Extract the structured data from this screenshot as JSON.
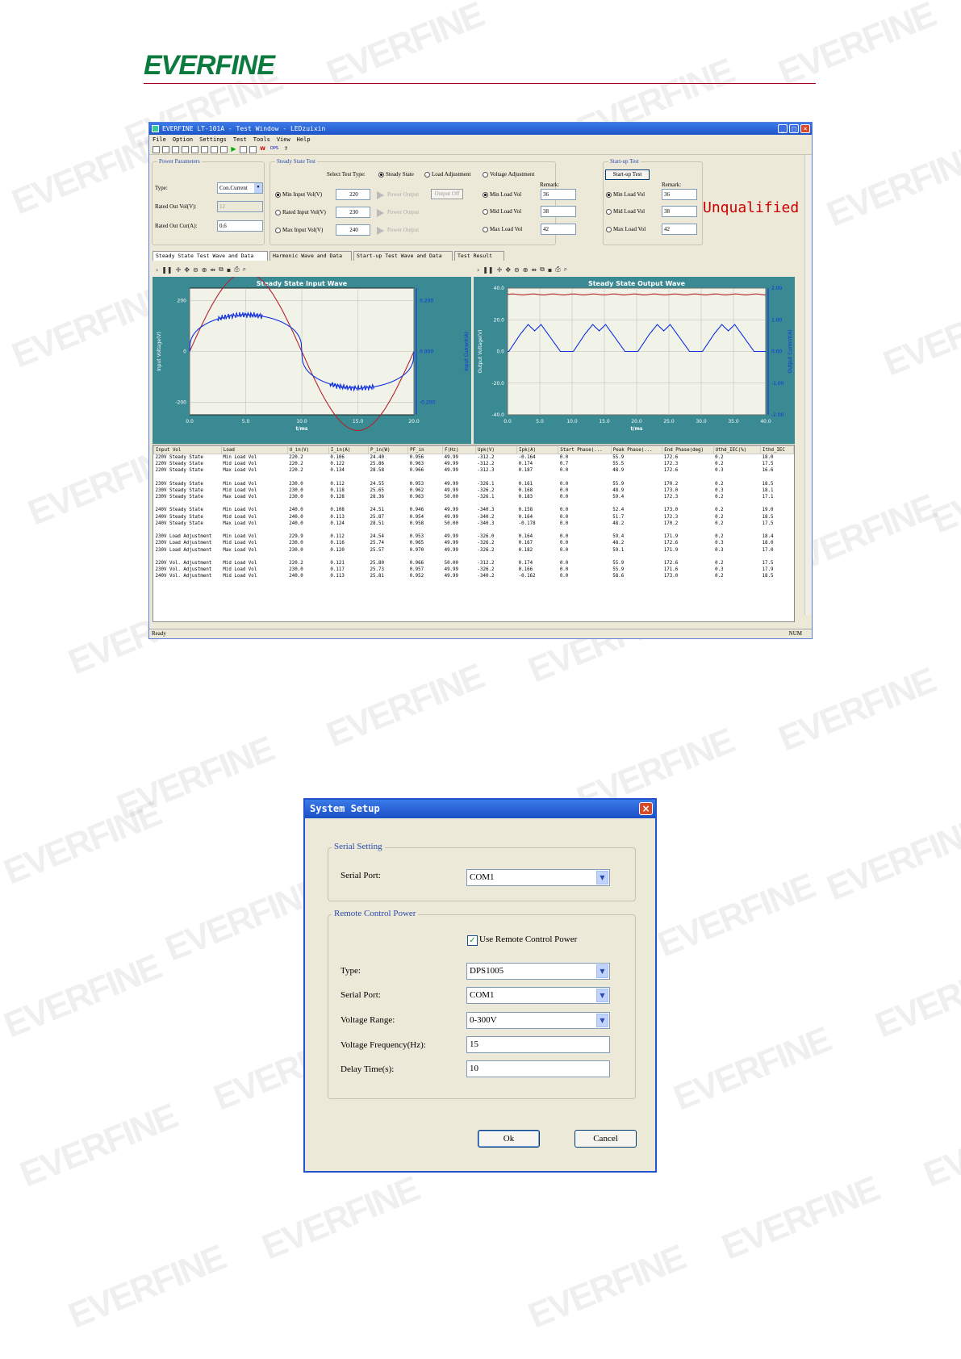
{
  "brand": {
    "logo": "EVERFINE",
    "watermark": "EVERFINE"
  },
  "app": {
    "title": "EVERFINE LT-101A - Test Window - LEDzuixin",
    "menu": [
      "File",
      "Option",
      "Settings",
      "Test",
      "Tools",
      "View",
      "Help"
    ],
    "power_params": {
      "title": "Power Parameters",
      "type_label": "Type:",
      "type_value": "Con.Current",
      "rated_vol_label": "Rated Out Vol(V):",
      "rated_vol_value": "12",
      "rated_cur_label": "Rated Out Cur(A):",
      "rated_cur_value": "0.6"
    },
    "steady": {
      "title": "Steady State Test",
      "select_label": "Select Test Type:",
      "opt_steady": "Steady State",
      "opt_load": "Load Adjustment",
      "opt_voltage": "Voltage Adjustment",
      "remark_label": "Remark:",
      "min_in_label": "Min  Input Vol(V)",
      "min_in_value": "220",
      "rated_in_label": "Rated Input Vol(V)",
      "rated_in_value": "230",
      "max_in_label": "Max  Input Vol(V)",
      "max_in_value": "240",
      "power_output": "Power Output",
      "output_off": "Output Off",
      "min_load": "Min Load Vol",
      "min_load_val": "36",
      "mid_load": "Mid Load Vol",
      "mid_load_val": "38",
      "max_load": "Max Load Vol",
      "max_load_val": "42"
    },
    "startup": {
      "title": "Start-up Test",
      "button": "Start-up Test",
      "remark_label": "Remark:",
      "min_load": "Min Load Vol",
      "min_load_val": "36",
      "mid_load": "Mid Load Vol",
      "mid_load_val": "38",
      "max_load": "Max Load Vol",
      "max_load_val": "42"
    },
    "result": "Unqualified",
    "tabs": [
      "Steady State Test Wave and Data",
      "Harmonic Wave and Data",
      "Start-up Test Wave and Data",
      "Test Result"
    ],
    "table": {
      "headers": [
        "Input Vol",
        "Load",
        "U_in(V)",
        "I_in(A)",
        "P_in(W)",
        "PF_in",
        "F(Hz)",
        "Upk(V)",
        "Ipk(A)",
        "Start Phase(...",
        "Peak Phase(...",
        "End Phase(deg)",
        "Uthd_IEC(%)",
        "Ithd_IEC"
      ],
      "rows": [
        [
          "220V Steady State",
          "Min Load Vol",
          "220.2",
          "0.106",
          "24.40",
          "0.956",
          "49.99",
          "-312.2",
          "-0.164",
          "0.0",
          "55.9",
          "172.6",
          "0.2",
          "18.0"
        ],
        [
          "220V Steady State",
          "Mid Load Vol",
          "220.2",
          "0.122",
          "25.86",
          "0.963",
          "49.99",
          "-312.2",
          "0.174",
          "0.7",
          "55.5",
          "172.3",
          "0.2",
          "17.5"
        ],
        [
          "220V Steady State",
          "Max Load Vol",
          "220.2",
          "0.134",
          "28.58",
          "0.966",
          "49.99",
          "-312.3",
          "0.187",
          "0.0",
          "48.9",
          "172.6",
          "0.3",
          "16.6"
        ],
        [],
        [
          "230V Steady State",
          "Min Load Vol",
          "230.0",
          "0.112",
          "24.55",
          "0.953",
          "49.99",
          "-326.1",
          "0.161",
          "0.0",
          "55.9",
          "170.2",
          "0.2",
          "18.5"
        ],
        [
          "230V Steady State",
          "Mid Load Vol",
          "230.0",
          "0.118",
          "25.65",
          "0.962",
          "49.99",
          "-326.2",
          "0.168",
          "0.0",
          "48.9",
          "173.0",
          "0.3",
          "18.1"
        ],
        [
          "230V Steady State",
          "Max Load Vol",
          "230.0",
          "0.128",
          "28.36",
          "0.963",
          "50.00",
          "-326.1",
          "0.183",
          "0.0",
          "59.4",
          "172.3",
          "0.2",
          "17.1"
        ],
        [],
        [
          "240V Steady State",
          "Min Load Vol",
          "240.0",
          "0.108",
          "24.51",
          "0.946",
          "49.99",
          "-340.3",
          "0.158",
          "0.0",
          "52.4",
          "173.0",
          "0.2",
          "19.0"
        ],
        [
          "240V Steady State",
          "Mid Load Vol",
          "240.0",
          "0.113",
          "25.87",
          "0.954",
          "49.99",
          "-340.2",
          "0.164",
          "0.0",
          "51.7",
          "172.3",
          "0.2",
          "18.5"
        ],
        [
          "240V Steady State",
          "Max Load Vol",
          "240.0",
          "0.124",
          "28.51",
          "0.958",
          "50.00",
          "-340.3",
          "-0.178",
          "0.0",
          "48.2",
          "170.2",
          "0.2",
          "17.5"
        ],
        [],
        [
          "230V Load Adjustment",
          "Min Load Vol",
          "229.9",
          "0.112",
          "24.54",
          "0.953",
          "49.99",
          "-326.0",
          "0.164",
          "0.0",
          "59.4",
          "171.9",
          "0.2",
          "18.4"
        ],
        [
          "230V Load Adjustment",
          "Mid Load Vol",
          "230.0",
          "0.116",
          "25.74",
          "0.965",
          "49.99",
          "-326.2",
          "0.167",
          "0.0",
          "48.2",
          "172.6",
          "0.3",
          "18.0"
        ],
        [
          "230V Load Adjustment",
          "Max Load Vol",
          "230.0",
          "0.120",
          "25.57",
          "0.970",
          "49.99",
          "-326.2",
          "0.182",
          "0.0",
          "59.1",
          "171.9",
          "0.3",
          "17.0"
        ],
        [],
        [
          "220V Vol. Adjustment",
          "Mid Load Vol",
          "220.2",
          "0.121",
          "25.80",
          "0.966",
          "50.00",
          "-312.2",
          "0.174",
          "0.0",
          "55.9",
          "172.6",
          "0.2",
          "17.5"
        ],
        [
          "230V Vol. Adjustment",
          "Mid Load Vol",
          "230.0",
          "0.117",
          "25.73",
          "0.957",
          "49.99",
          "-326.2",
          "0.166",
          "0.0",
          "55.9",
          "171.6",
          "0.3",
          "17.9"
        ],
        [
          "240V Vol. Adjustment",
          "Mid Load Vol",
          "240.0",
          "0.113",
          "25.81",
          "0.952",
          "49.99",
          "-340.2",
          "-0.162",
          "0.0",
          "58.6",
          "173.0",
          "0.2",
          "18.5"
        ]
      ]
    },
    "status_left": "Ready",
    "status_right": "NUM"
  },
  "chart_data": [
    {
      "type": "line",
      "title": "Steady State Input Wave",
      "xlabel": "t/ms",
      "ylabel": "Input Voltage(V)",
      "y2label": "Input Current(A)",
      "xlim": [
        0,
        20
      ],
      "ylim": [
        -250,
        250
      ],
      "y2lim": [
        -0.25,
        0.25
      ],
      "xticks": [
        "0.0",
        "5.0",
        "10.0",
        "15.0",
        "20.0"
      ],
      "yticks": [
        "200",
        "0",
        "-200"
      ],
      "y2ticks": [
        "0.200",
        "0.000",
        "-0.200"
      ],
      "series": [
        {
          "axis": "left",
          "color": "#b0232a",
          "kind": "sine",
          "amplitude": 312
        },
        {
          "axis": "right",
          "color": "#1030e0",
          "kind": "led_current",
          "amplitude": 0.17
        }
      ]
    },
    {
      "type": "line",
      "title": "Steady State Output Wave",
      "xlabel": "t/ms",
      "ylabel": "Output Voltage(V)",
      "y2label": "Output Current(A)",
      "xlim": [
        0,
        40
      ],
      "ylim": [
        -40,
        40
      ],
      "y2lim": [
        -2,
        2
      ],
      "xticks": [
        "0.0",
        "5.0",
        "10.0",
        "15.0",
        "20.0",
        "25.0",
        "30.0",
        "35.0",
        "40.0"
      ],
      "yticks": [
        "40.0",
        "20.0",
        "0.0",
        "-20.0",
        "-40.0"
      ],
      "y2ticks": [
        "2.00",
        "1.00",
        "0.00",
        "-1.00",
        "-2.00"
      ],
      "series": [
        {
          "axis": "left",
          "color": "#b0232a",
          "kind": "flat",
          "value": 36
        },
        {
          "axis": "right",
          "color": "#1030e0",
          "kind": "ripple",
          "period": 10
        }
      ]
    }
  ],
  "dialog": {
    "title": "System  Setup",
    "serial_group": "Serial Setting",
    "serial_port_label": "Serial Port:",
    "serial_port_value": "COM1",
    "remote_group": "Remote Control Power",
    "use_remote_label": "Use Remote Control Power",
    "type_label": "Type:",
    "type_value": "DPS1005",
    "rport_label": "Serial Port:",
    "rport_value": "COM1",
    "vrange_label": "Voltage Range:",
    "vrange_value": "0-300V",
    "vfreq_label": "Voltage Frequency(Hz):",
    "vfreq_value": "15",
    "delay_label": "Delay Time(s):",
    "delay_value": "10",
    "ok": "Ok",
    "cancel": "Cancel"
  }
}
